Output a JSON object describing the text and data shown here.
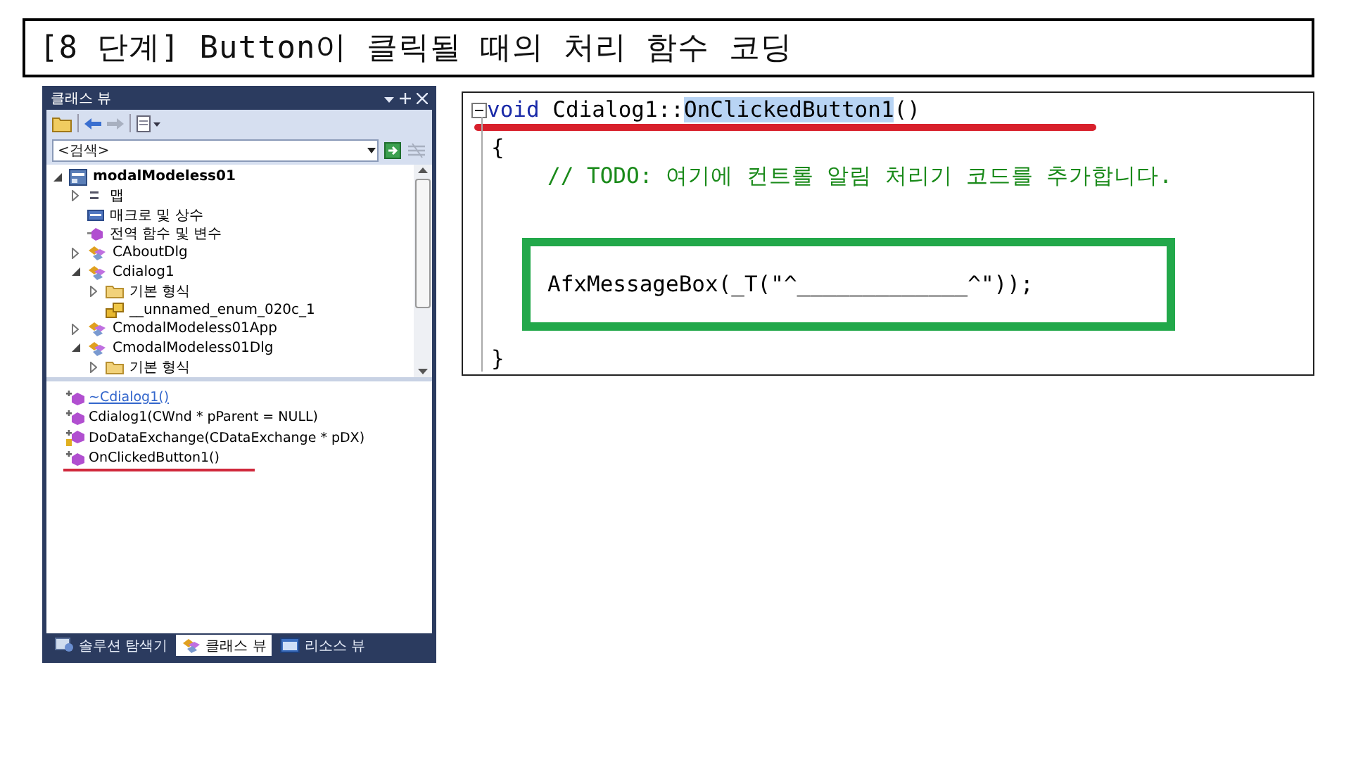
{
  "title": "[8 단계] Button이 클릭될 때의 처리 함수 코딩",
  "class_view": {
    "title": "클래스 뷰",
    "search": {
      "placeholder": "<검색>"
    },
    "tree": [
      {
        "label": "modalModeless01",
        "kind": "project",
        "expanded": true,
        "children": [
          {
            "label": "맵",
            "kind": "map",
            "expanded": false
          },
          {
            "label": "매크로 및 상수",
            "kind": "macro"
          },
          {
            "label": "전역 함수 및 변수",
            "kind": "global"
          },
          {
            "label": "CAboutDlg",
            "kind": "class",
            "expanded": false
          },
          {
            "label": "Cdialog1",
            "kind": "class",
            "expanded": true,
            "children": [
              {
                "label": "기본 형식",
                "kind": "folder",
                "expanded": false
              },
              {
                "label": "__unnamed_enum_020c_1",
                "kind": "enum"
              }
            ]
          },
          {
            "label": "CmodalModeless01App",
            "kind": "class",
            "expanded": false
          },
          {
            "label": "CmodalModeless01Dlg",
            "kind": "class",
            "expanded": true,
            "children": [
              {
                "label": "기본 형식",
                "kind": "folder",
                "expanded": false
              }
            ]
          }
        ]
      }
    ],
    "members": [
      {
        "label": "~Cdialog1()",
        "kind": "public",
        "selected": true,
        "underlined": false
      },
      {
        "label": "Cdialog1(CWnd * pParent = NULL)",
        "kind": "public",
        "selected": false,
        "underlined": false
      },
      {
        "label": "DoDataExchange(CDataExchange * pDX)",
        "kind": "protected",
        "selected": false,
        "underlined": false
      },
      {
        "label": "OnClickedButton1()",
        "kind": "public",
        "selected": false,
        "underlined": true
      }
    ],
    "tabs": [
      {
        "label": "솔루션 탐색기",
        "kind": "solution",
        "selected": false
      },
      {
        "label": "클래스 뷰",
        "kind": "classview",
        "selected": true
      },
      {
        "label": "리소스 뷰",
        "kind": "resource",
        "selected": false
      }
    ]
  },
  "code": {
    "lines": [
      {
        "kind": "signature",
        "keyword": "void",
        "scope": "Cdialog1::",
        "name": "OnClickedButton1",
        "params": "()",
        "underlined": true
      },
      {
        "kind": "brace",
        "text": "{"
      },
      {
        "kind": "comment",
        "text": "// TODO: 여기에 컨트롤 알림 처리기 코드를 추가합니다.",
        "boxed": false
      },
      {
        "kind": "call",
        "text": "AfxMessageBox(_T(\"^_____________^\"));",
        "boxed": true
      },
      {
        "kind": "brace",
        "text": "}"
      }
    ]
  }
}
